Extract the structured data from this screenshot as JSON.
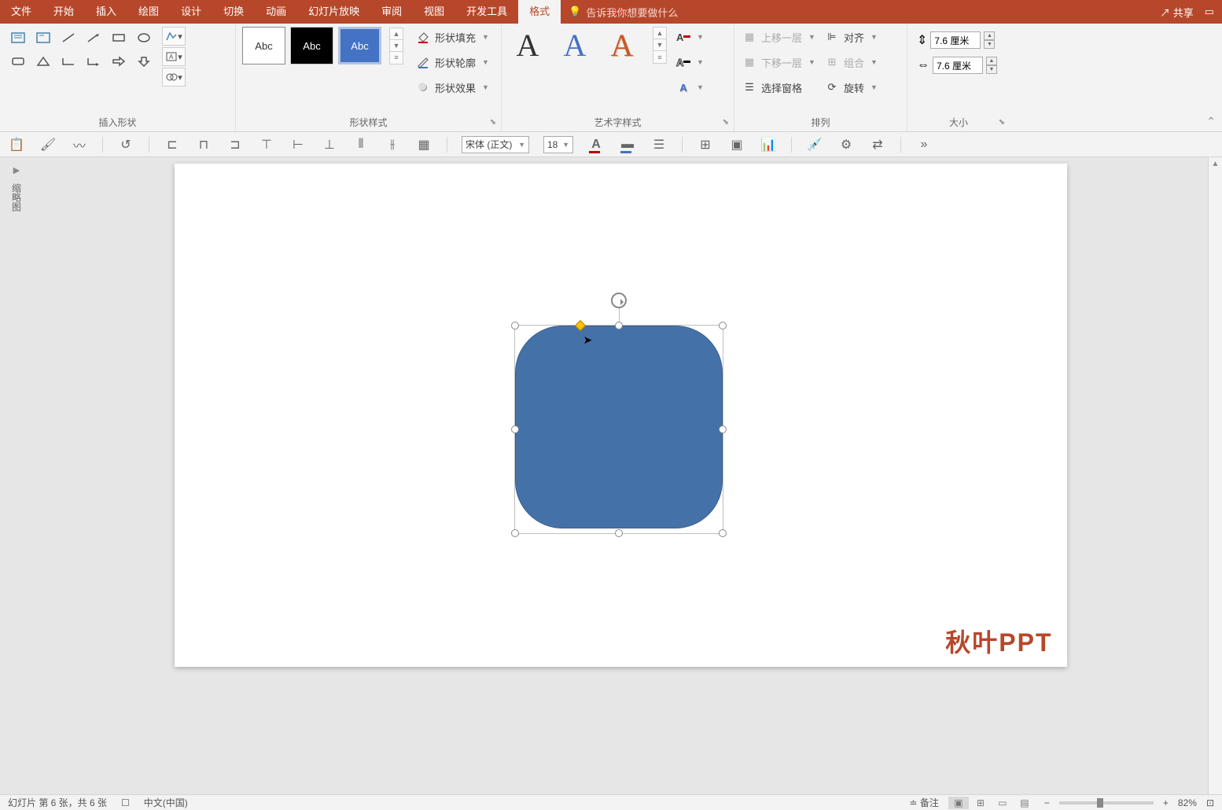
{
  "menu": {
    "items": [
      "文件",
      "开始",
      "插入",
      "绘图",
      "设计",
      "切换",
      "动画",
      "幻灯片放映",
      "审阅",
      "视图",
      "开发工具",
      "格式"
    ],
    "active_index": 11,
    "tellme_placeholder": "告诉我你想要做什么",
    "share": "共享"
  },
  "ribbon": {
    "groups": {
      "insert_shapes": "插入形状",
      "shape_styles": "形状样式",
      "wordart_styles": "艺术字样式",
      "arrange": "排列",
      "size": "大小"
    },
    "shape_fill": "形状填充",
    "shape_outline": "形状轮廓",
    "shape_effects": "形状效果",
    "text_fill_label": "A",
    "bring_forward": "上移一层",
    "send_backward": "下移一层",
    "selection_pane": "选择窗格",
    "align": "对齐",
    "group": "组合",
    "rotate": "旋转",
    "style_labels": [
      "Abc",
      "Abc",
      "Abc"
    ],
    "height_value": "7.6 厘米",
    "width_value": "7.6 厘米"
  },
  "toolbar2": {
    "font_name": "宋体 (正文)",
    "font_size": "18"
  },
  "sidebar": {
    "thumbnails_label": "缩略图"
  },
  "canvas": {
    "watermark": "秋叶PPT"
  },
  "statusbar": {
    "slide_info": "幻灯片 第 6 张，共 6 张",
    "language": "中文(中国)",
    "notes": "备注",
    "zoom_pct": "82%"
  }
}
